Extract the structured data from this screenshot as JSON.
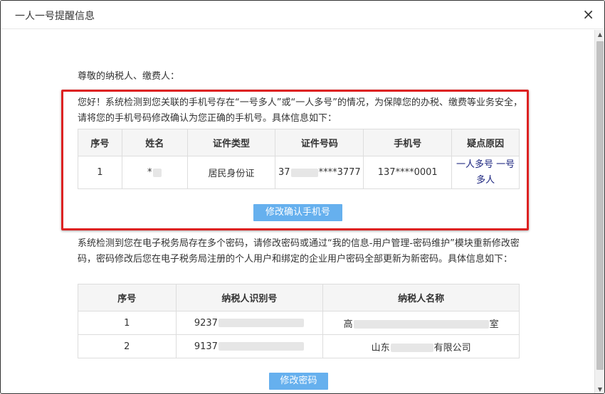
{
  "dialog": {
    "title": "一人一号提醒信息",
    "close_icon": "×"
  },
  "salutation": "尊敬的纳税人、缴费人：",
  "section1": {
    "text": "您好！系统检测到您关联的手机号存在“一号多人”或“一人多号”的情况，为保障您的办税、缴费等业务安全，请将您的手机号码修改确认为您正确的手机号。具体信息如下：",
    "headers": [
      "序号",
      "姓名",
      "证件类型",
      "证件号码",
      "手机号",
      "疑点原因"
    ],
    "rows": [
      {
        "no": "1",
        "name_prefix": "*",
        "id_type": "居民身份证",
        "id_prefix": "37",
        "id_suffix": "****3777",
        "phone": "137****0001",
        "reason": "一人多号 一号多人"
      }
    ],
    "button": "修改确认手机号"
  },
  "section2": {
    "text": "系统检测到您在电子税务局存在多个密码，请修改密码或通过“我的信息-用户管理-密码维护”模块重新修改密码，密码修改后您在电子税务局注册的个人用户和绑定的企业用户密码全部更新为新密码。具体信息如下：",
    "headers": [
      "序号",
      "纳税人识别号",
      "纳税人名称"
    ],
    "rows": [
      {
        "no": "1",
        "tax_id_prefix": "9237",
        "name_prefix": "高",
        "name_suffix": "室"
      },
      {
        "no": "2",
        "tax_id_prefix": "9137",
        "name_prefix": "山东",
        "name_suffix": "有限公司"
      }
    ],
    "button": "修改密码"
  },
  "scrollbar": {
    "up_icon": "▲",
    "down_icon": "▼"
  }
}
